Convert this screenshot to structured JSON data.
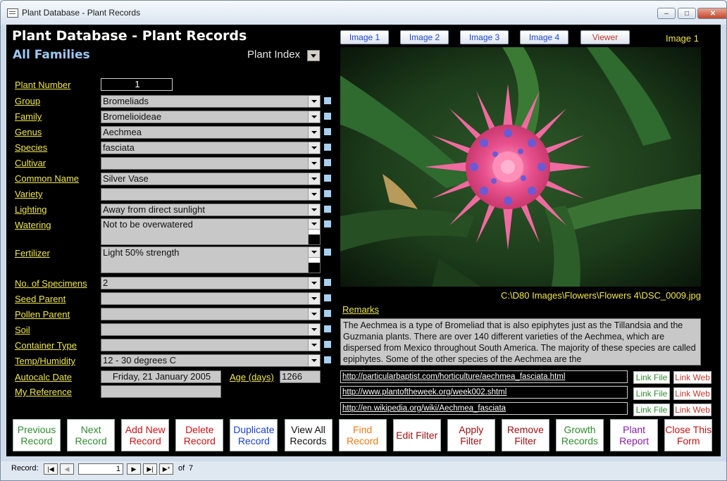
{
  "window": {
    "title": "Plant Database - Plant Records",
    "buttons": {
      "minimize": "–",
      "maximize": "□",
      "close": "✕"
    }
  },
  "form": {
    "heading": "Plant Database - Plant Records",
    "subheading": "All Families",
    "plant_index_label": "Plant Index",
    "fields": [
      {
        "label": "Plant Number",
        "value": "1"
      },
      {
        "label": "Group",
        "value": "Bromeliads"
      },
      {
        "label": "Family",
        "value": "Bromelioideae"
      },
      {
        "label": "Genus",
        "value": "Aechmea"
      },
      {
        "label": "Species",
        "value": "fasciata"
      },
      {
        "label": "Cultivar",
        "value": ""
      },
      {
        "label": "Common Name",
        "value": "Silver Vase"
      },
      {
        "label": "Variety",
        "value": ""
      },
      {
        "label": "Lighting",
        "value": "Away from direct sunlight"
      },
      {
        "label": "Watering",
        "value": "Not to be overwatered"
      },
      {
        "label": "Fertilizer",
        "value": "Light 50% strength"
      },
      {
        "label": "No. of Specimens",
        "value": "2"
      },
      {
        "label": "Seed Parent",
        "value": ""
      },
      {
        "label": "Pollen Parent",
        "value": ""
      },
      {
        "label": "Soil",
        "value": ""
      },
      {
        "label": "Container Type",
        "value": ""
      },
      {
        "label": "Temp/Humidity",
        "value": "12 - 30 degrees C"
      },
      {
        "label": "Autocalc Date",
        "value": "Friday, 21 January 2005"
      },
      {
        "label": "My Reference",
        "value": ""
      }
    ],
    "age_label": "Age (days)",
    "age_value": "1266"
  },
  "image_panel": {
    "buttons": [
      "Image 1",
      "Image 2",
      "Image 3",
      "Image 4",
      "Viewer"
    ],
    "current_image_label": "Image 1",
    "path": "C:\\D80 Images\\Flowers\\Flowers 4\\DSC_0009.jpg",
    "remarks_label": "Remarks",
    "remarks_text": "The Aechmea is a type of Bromeliad that is also epiphytes just as the Tillandsia and the Guzmania plants. There are over 140 different varieties of the Aechmea, which are dispersed from Mexico throughout South America. The majority of these species are called epiphytes. Some of the other species of the Aechmea are the",
    "links": [
      "http://particularbaptist.com/horticulture/aechmea_fasciata.html",
      "http://www.plantoftheweek.org/week002.shtml",
      "http://en.wikipedia.org/wiki/Aechmea_fasciata"
    ],
    "link_file_label": "Link File",
    "link_web_label": "Link Web"
  },
  "bottom_buttons": [
    {
      "label": "Previous Record",
      "color": "#2e8b2e"
    },
    {
      "label": "Next Record",
      "color": "#2e8b2e"
    },
    {
      "label": "Add New Record",
      "color": "#cc1111"
    },
    {
      "label": "Delete Record",
      "color": "#cc1111"
    },
    {
      "label": "Duplicate Record",
      "color": "#1a3fd6"
    },
    {
      "label": "View All Records",
      "color": "#111111"
    },
    {
      "label": "Find Record",
      "color": "#f07a10"
    },
    {
      "label": "Edit Filter",
      "color": "#a01010"
    },
    {
      "label": "Apply Filter",
      "color": "#a01010"
    },
    {
      "label": "Remove Filter",
      "color": "#a01010"
    },
    {
      "label": "Growth Records",
      "color": "#2e8b2e"
    },
    {
      "label": "Plant Report",
      "color": "#8a1aa8"
    },
    {
      "label": "Close This Form",
      "color": "#cc1111"
    }
  ],
  "record_nav": {
    "label": "Record:",
    "current": "1",
    "of_label": "of",
    "total": "7"
  },
  "colors": {
    "label": "#f2e84c",
    "form_bg": "#000000",
    "field_bg": "#c8c8c8",
    "accent": "#9ec8f2"
  }
}
